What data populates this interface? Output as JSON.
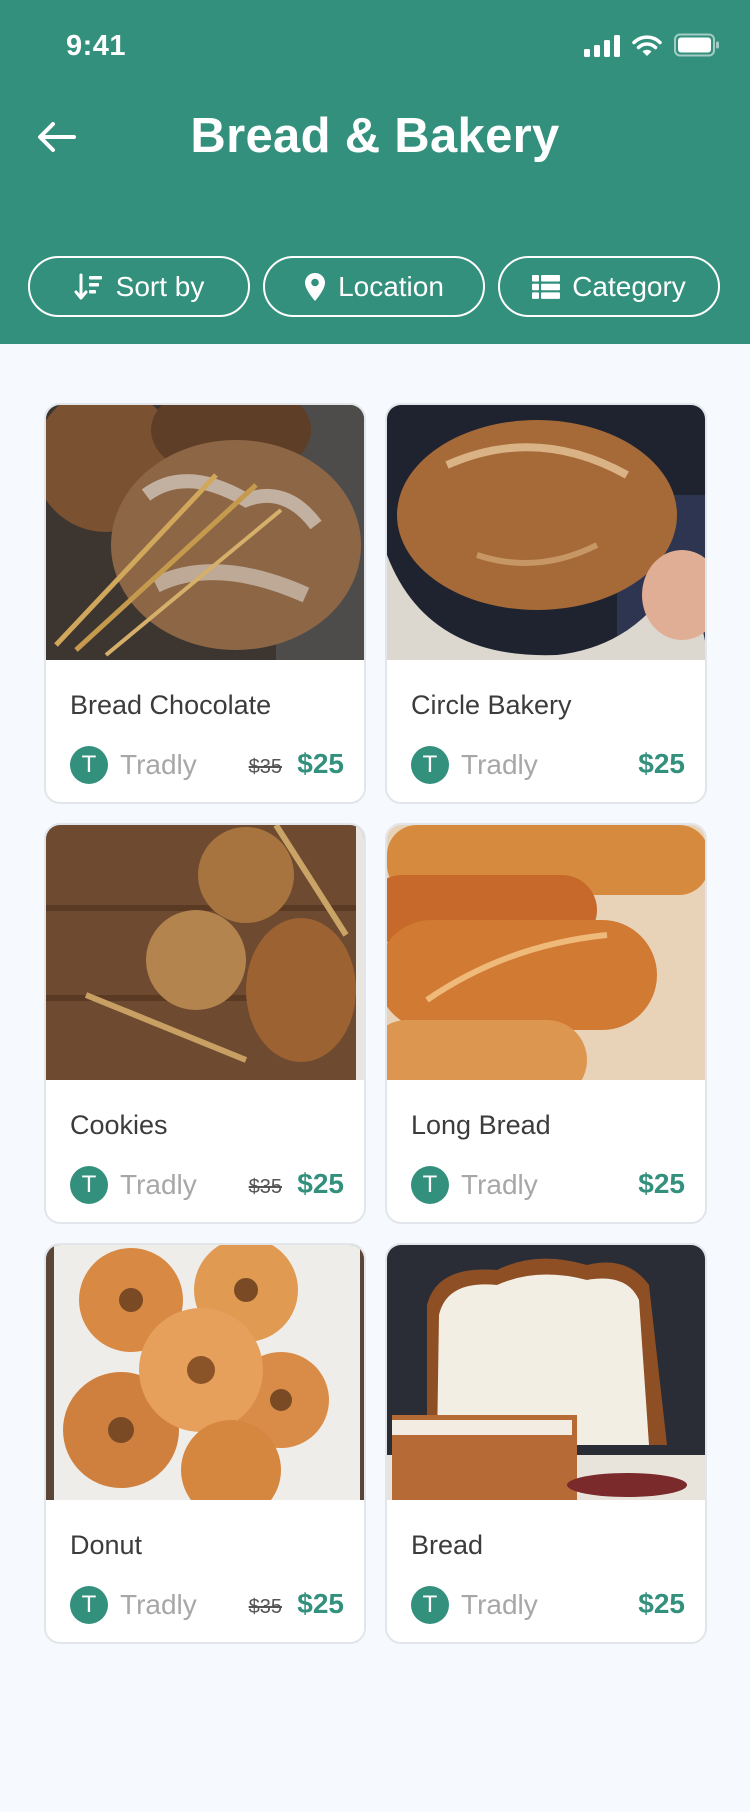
{
  "status_bar": {
    "time": "9:41"
  },
  "header": {
    "title": "Bread & Bakery",
    "back_icon": "arrow-left-icon"
  },
  "filters": [
    {
      "label": "Sort by",
      "icon": "sort-icon"
    },
    {
      "label": "Location",
      "icon": "map-pin-icon"
    },
    {
      "label": "Category",
      "icon": "list-grid-icon"
    }
  ],
  "products": [
    {
      "name": "Bread Chocolate",
      "store_initial": "T",
      "store": "Tradly",
      "old_price": "$35",
      "price": "$25"
    },
    {
      "name": "Circle Bakery",
      "store_initial": "T",
      "store": "Tradly",
      "old_price": "",
      "price": "$25"
    },
    {
      "name": "Cookies",
      "store_initial": "T",
      "store": "Tradly",
      "old_price": "$35",
      "price": "$25"
    },
    {
      "name": "Long Bread",
      "store_initial": "T",
      "store": "Tradly",
      "old_price": "",
      "price": "$25"
    },
    {
      "name": "Donut",
      "store_initial": "T",
      "store": "Tradly",
      "old_price": "$35",
      "price": "$25"
    },
    {
      "name": "Bread",
      "store_initial": "T",
      "store": "Tradly",
      "old_price": "",
      "price": "$25"
    }
  ],
  "colors": {
    "brand": "#33907c",
    "background": "#f6f9fe",
    "muted": "#a7a7a7"
  }
}
